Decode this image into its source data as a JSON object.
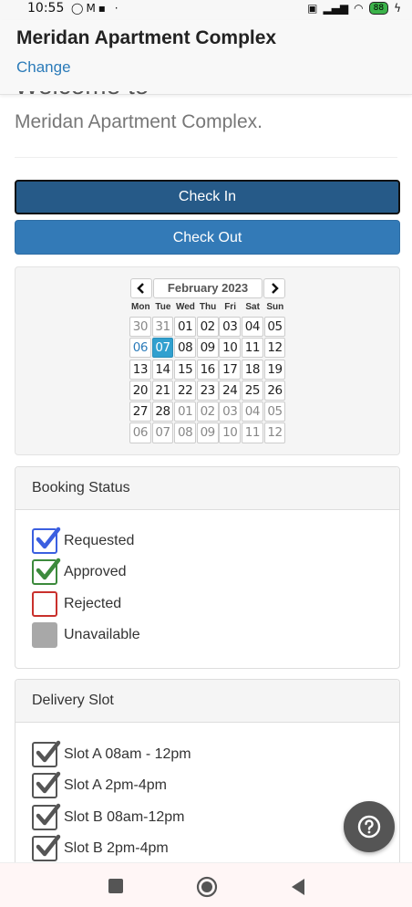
{
  "status_bar": {
    "time": "10:55",
    "left_icons": "whatsapp-icon gmail-icon notification-icon",
    "battery": "88"
  },
  "header": {
    "title": "Meridan Apartment Complex",
    "change_link": "Change"
  },
  "intro": {
    "cut_text": "Welcome to",
    "subtitle": "Meridan Apartment Complex."
  },
  "actions": {
    "check_in": "Check In",
    "check_out": "Check Out"
  },
  "calendar": {
    "prev": "‹",
    "next": "›",
    "title": "February 2023",
    "dows": [
      "Mon",
      "Tue",
      "Wed",
      "Thu",
      "Fri",
      "Sat",
      "Sun"
    ],
    "weeks": [
      [
        "30",
        "31",
        "01",
        "02",
        "03",
        "04",
        "05"
      ],
      [
        "06",
        "07",
        "08",
        "09",
        "10",
        "11",
        "12"
      ],
      [
        "13",
        "14",
        "15",
        "16",
        "17",
        "18",
        "19"
      ],
      [
        "20",
        "21",
        "22",
        "23",
        "24",
        "25",
        "26"
      ],
      [
        "27",
        "28",
        "01",
        "02",
        "03",
        "04",
        "05"
      ],
      [
        "06",
        "07",
        "08",
        "09",
        "10",
        "11",
        "12"
      ]
    ],
    "selected": "07"
  },
  "booking_status": {
    "heading": "Booking Status",
    "items": [
      {
        "label": "Requested",
        "state": "checked",
        "color": "#3b5fe0"
      },
      {
        "label": "Approved",
        "state": "checked",
        "color": "#3c8a3c"
      },
      {
        "label": "Rejected",
        "state": "empty",
        "color": "#c9302c"
      },
      {
        "label": "Unavailable",
        "state": "filled",
        "color": "#a8a8a8"
      }
    ]
  },
  "delivery_slot": {
    "heading": "Delivery Slot",
    "items": [
      {
        "label": "Slot A 08am - 12pm",
        "state": "checked",
        "color": "#555555"
      },
      {
        "label": "Slot A 2pm-4pm",
        "state": "checked",
        "color": "#555555"
      },
      {
        "label": "Slot B 08am-12pm",
        "state": "checked",
        "color": "#555555"
      },
      {
        "label": "Slot B 2pm-4pm",
        "state": "checked",
        "color": "#555555"
      }
    ]
  },
  "help": {
    "icon": "question-icon"
  },
  "nav": {
    "icons": [
      "recents-square-icon",
      "home-circle-icon",
      "back-triangle-icon"
    ]
  },
  "colors": {
    "primary_dark": "#265a88",
    "primary": "#337ab7",
    "link": "#2b7bb9",
    "selected_day": "#31a0cf"
  }
}
